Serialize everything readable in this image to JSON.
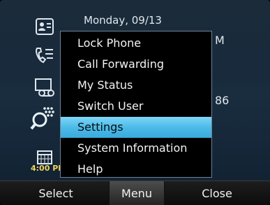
{
  "background": {
    "date": "Monday, 09/13",
    "time_fragment": "M",
    "number_fragment": "86",
    "clock": "4:00 PI"
  },
  "sidebar_icons": [
    "contacts-icon",
    "call-history-icon",
    "voicemail-icon",
    "directory-search-icon",
    "calendar-icon"
  ],
  "menu": {
    "items": [
      {
        "label": "Lock Phone",
        "selected": false
      },
      {
        "label": "Call Forwarding",
        "selected": false
      },
      {
        "label": "My Status",
        "selected": false
      },
      {
        "label": "Switch User",
        "selected": false
      },
      {
        "label": "Settings",
        "selected": true
      },
      {
        "label": "System Information",
        "selected": false
      },
      {
        "label": "Help",
        "selected": false
      }
    ]
  },
  "softkeys": {
    "select": "Select",
    "menu": "Menu",
    "close": "Close"
  },
  "colors": {
    "highlight": "#4cbbe9",
    "menu_background": "#000000",
    "clock_text": "#f1d35c"
  }
}
